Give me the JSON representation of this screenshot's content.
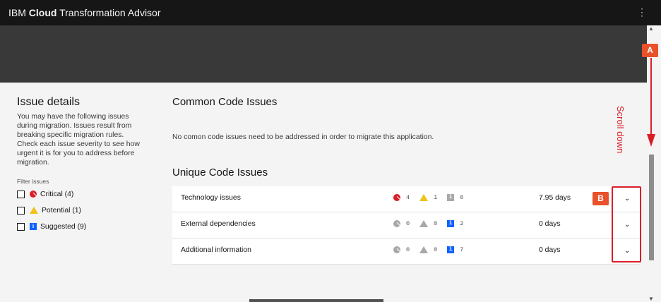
{
  "header": {
    "brand_prefix": "IBM",
    "brand_bold": "Cloud",
    "brand_suffix": "Transformation Advisor",
    "menu_icon": "⋮"
  },
  "sidebar": {
    "title": "Issue details",
    "description": "You may have the following issues during migration. Issues result from breaking specific migration rules. Check each issue severity to see how urgent it is for you to address before migration.",
    "filter_title": "Filter issues",
    "filters": [
      {
        "label": "Critical (4)",
        "icon": "critical-icon",
        "checked": false
      },
      {
        "label": "Potential (1)",
        "icon": "warning-icon",
        "checked": false
      },
      {
        "label": "Suggested (9)",
        "icon": "info-icon",
        "checked": false
      }
    ]
  },
  "main": {
    "common_title": "Common Code Issues",
    "common_message": "No comon code issues need to be addressed in order to migrate this application.",
    "unique_title": "Unique Code Issues",
    "rows": [
      {
        "name": "Technology issues",
        "critical": "4",
        "potential": "1",
        "suggested": "0",
        "days": "7.95 days",
        "critical_active": true,
        "potential_active": true,
        "suggested_active": false
      },
      {
        "name": "External dependencies",
        "critical": "0",
        "potential": "0",
        "suggested": "2",
        "days": "0 days",
        "critical_active": false,
        "potential_active": false,
        "suggested_active": true
      },
      {
        "name": "Additional information",
        "critical": "0",
        "potential": "0",
        "suggested": "7",
        "days": "0 days",
        "critical_active": false,
        "potential_active": false,
        "suggested_active": true
      }
    ]
  },
  "annotations": {
    "badge_a": "A",
    "badge_b": "B",
    "scroll_label": "Scroll down",
    "accent_color": "#da1e28"
  }
}
